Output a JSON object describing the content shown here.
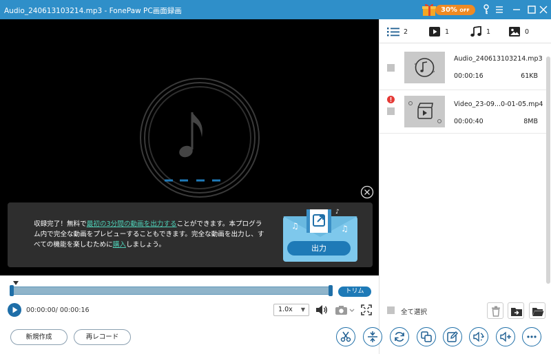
{
  "window": {
    "title": "Audio_240613103214.mp3  -  FonePaw PC画面録画",
    "promo_percent": "30%",
    "promo_off": "OFF"
  },
  "player": {
    "notice_pre": "収録完了！無料で",
    "notice_link1": "最初の3分間の動画を出力する",
    "notice_mid": "ことができます。本プログラム内で完全な動画をプレビューすることもできます。完全な動画を出力し、すべての機能を楽しむために",
    "notice_link2": "購入",
    "notice_post": "しましょう。",
    "export_label": "出力"
  },
  "controls": {
    "trim_label": "トリム",
    "time": "00:00:00/ 00:00:16",
    "speed": "1.0x",
    "new_label": "新規作成",
    "rerecord_label": "再レコード"
  },
  "panel": {
    "tabs": [
      {
        "icon": "list-icon",
        "count": "2"
      },
      {
        "icon": "video-icon",
        "count": "1"
      },
      {
        "icon": "music-icon",
        "count": "1"
      },
      {
        "icon": "image-icon",
        "count": "0"
      }
    ],
    "files": [
      {
        "name": "Audio_240613103214.mp3",
        "duration": "00:00:16",
        "size": "61KB"
      },
      {
        "name": "Video_23-09...0-01-05.mp4",
        "duration": "00:00:40",
        "size": "8MB"
      }
    ],
    "select_all_label": "全て選択"
  },
  "colors": {
    "titlebar": "#2f8fc9",
    "accent": "#1e7ab7",
    "promo": "#f08a22",
    "link": "#4fd1b8",
    "warning": "#e53935"
  }
}
